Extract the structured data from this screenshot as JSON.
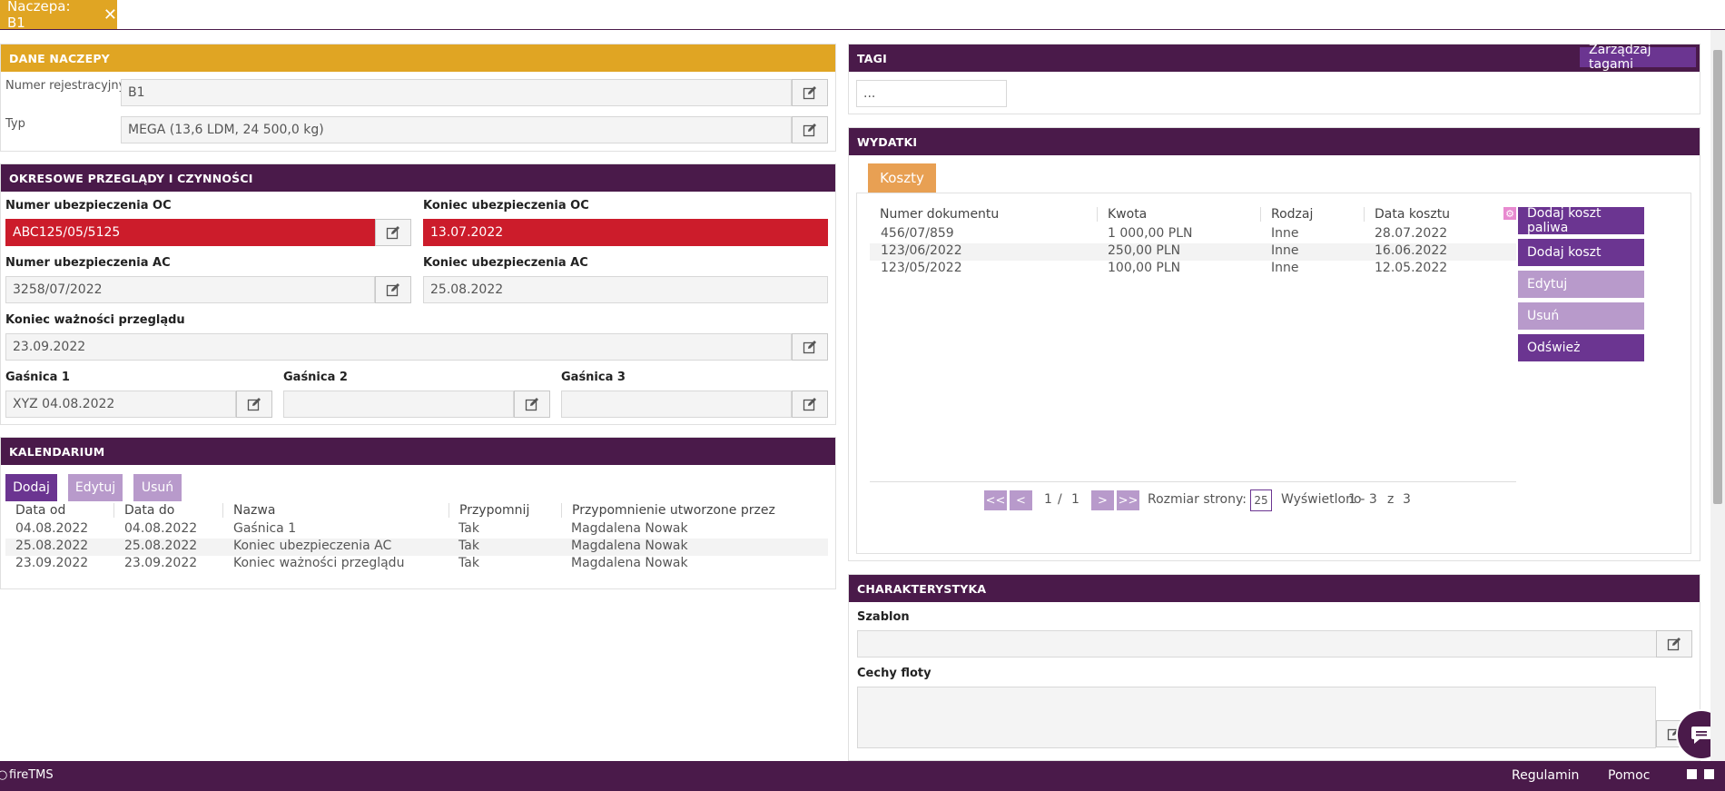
{
  "tab": {
    "title": "Naczepa: B1",
    "close": "✕"
  },
  "dane": {
    "title": "DANE NACZEPY",
    "reg_label": "Numer rejestracyjny",
    "reg_value": "B1",
    "typ_label": "Typ",
    "typ_value": "MEGA (13,6 LDM, 24 500,0 kg)"
  },
  "okresowe": {
    "title": "OKRESOWE PRZEGLĄDY I CZYNNOŚCI",
    "oc_num_label": "Numer ubezpieczenia OC",
    "oc_num_value": "ABC125/05/5125",
    "oc_end_label": "Koniec ubezpieczenia OC",
    "oc_end_value": "13.07.2022",
    "ac_num_label": "Numer ubezpieczenia AC",
    "ac_num_value": "3258/07/2022",
    "ac_end_label": "Koniec ubezpieczenia AC",
    "ac_end_value": "25.08.2022",
    "przeglad_label": "Koniec ważności przeglądu",
    "przeglad_value": "23.09.2022",
    "g1_label": "Gaśnica 1",
    "g1_value": "XYZ 04.08.2022",
    "g2_label": "Gaśnica 2",
    "g2_value": "",
    "g3_label": "Gaśnica 3",
    "g3_value": ""
  },
  "kalendarium": {
    "title": "KALENDARIUM",
    "buttons": {
      "add": "Dodaj",
      "edit": "Edytuj",
      "delete": "Usuń"
    },
    "columns": [
      "Data od",
      "Data do",
      "Nazwa",
      "Przypomnij",
      "Przypomnienie utworzone przez"
    ],
    "rows": [
      [
        "04.08.2022",
        "04.08.2022",
        "Gaśnica 1",
        "Tak",
        "Magdalena Nowak"
      ],
      [
        "25.08.2022",
        "25.08.2022",
        "Koniec ubezpieczenia AC",
        "Tak",
        "Magdalena Nowak"
      ],
      [
        "23.09.2022",
        "23.09.2022",
        "Koniec ważności przeglądu",
        "Tak",
        "Magdalena Nowak"
      ]
    ]
  },
  "tagi": {
    "title": "TAGI",
    "manage": "Zarządzaj tagami",
    "value": "..."
  },
  "wydatki": {
    "title": "WYDATKI",
    "subtab": "Koszty",
    "columns": [
      "Numer dokumentu",
      "Kwota",
      "Rodzaj",
      "Data kosztu"
    ],
    "rows": [
      [
        "456/07/859",
        "1 000,00 PLN",
        "Inne",
        "28.07.2022"
      ],
      [
        "123/06/2022",
        "250,00 PLN",
        "Inne",
        "16.06.2022"
      ],
      [
        "123/05/2022",
        "100,00 PLN",
        "Inne",
        "12.05.2022"
      ]
    ],
    "buttons": {
      "add_fuel": "Dodaj koszt paliwa",
      "add": "Dodaj koszt",
      "edit": "Edytuj",
      "delete": "Usuń",
      "refresh": "Odśwież"
    },
    "pager": {
      "first": "<<",
      "prev": "<",
      "next": ">",
      "last": ">>",
      "page": "1",
      "sep": "/",
      "pages": "1",
      "size_label": "Rozmiar strony:",
      "size": "25",
      "shown_label": "Wyświetlono",
      "range": "1 - 3",
      "of": "z",
      "total": "3"
    }
  },
  "charakterystyka": {
    "title": "CHARAKTERYSTYKA",
    "szablon_label": "Szablon",
    "szablon_value": "",
    "cechy_label": "Cechy floty",
    "cechy_value": ""
  },
  "footer": {
    "brand": "fireTMS",
    "terms": "Regulamin",
    "help": "Pomoc"
  }
}
